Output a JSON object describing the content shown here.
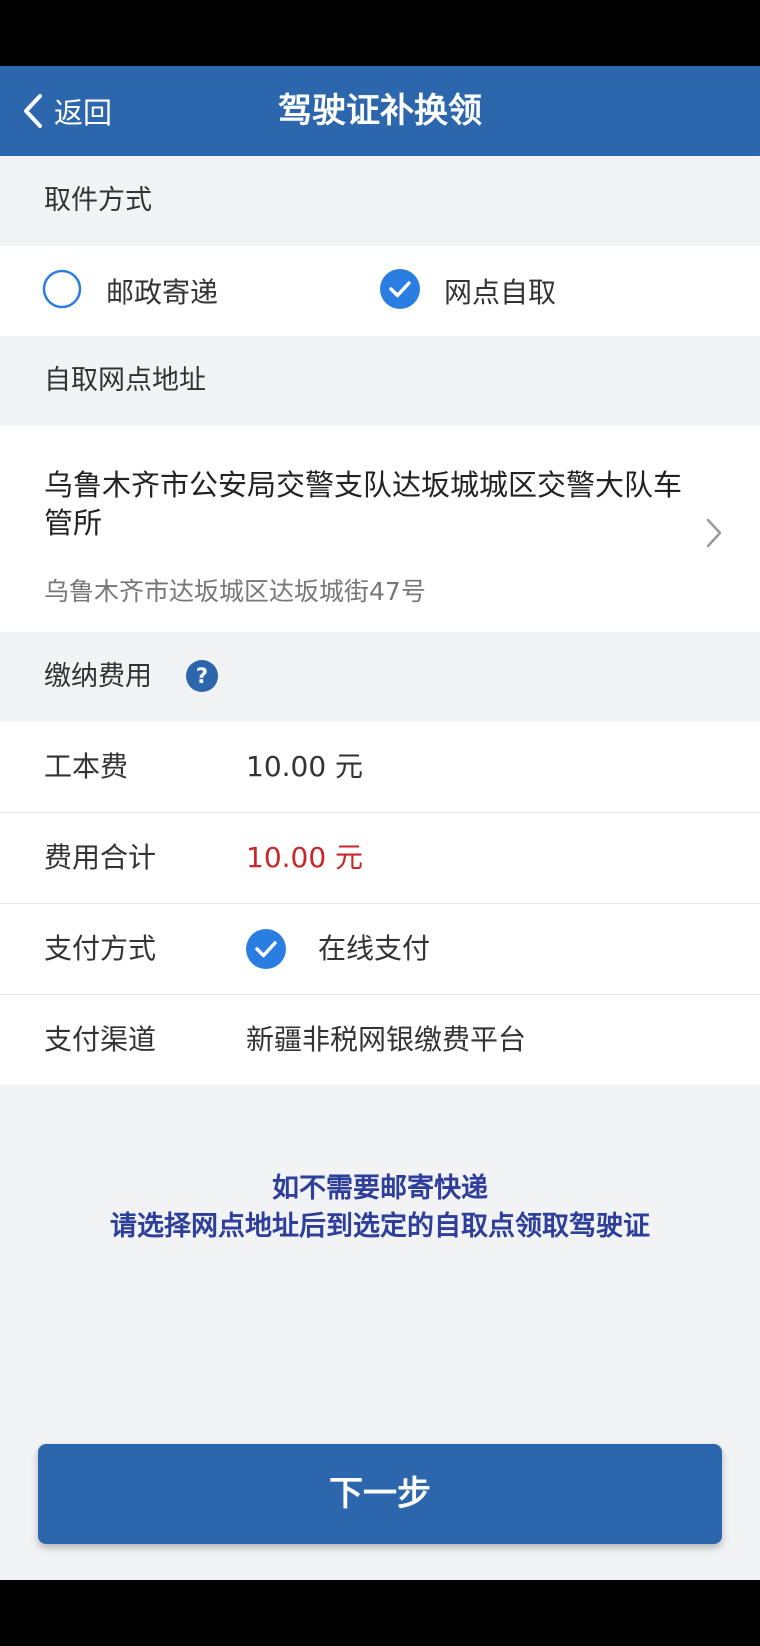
{
  "header": {
    "back_label": "返回",
    "title": "驾驶证补换领"
  },
  "pickup": {
    "section_title": "取件方式",
    "options": [
      {
        "label": "邮政寄递",
        "selected": false
      },
      {
        "label": "网点自取",
        "selected": true
      }
    ]
  },
  "address": {
    "section_title": "自取网点地址",
    "name": "乌鲁木齐市公安局交警支队达坂城城区交警大队车管所",
    "detail": "乌鲁木齐市达坂城区达坂城街47号"
  },
  "fees": {
    "section_title": "缴纳费用",
    "rows": [
      {
        "key": "工本费",
        "value": "10.00 元"
      },
      {
        "key": "费用合计",
        "value": "10.00 元"
      },
      {
        "key": "支付方式",
        "value": "在线支付"
      },
      {
        "key": "支付渠道",
        "value": "新疆非税网银缴费平台"
      }
    ]
  },
  "notice": {
    "line1": "如不需要邮寄快递",
    "line2": "请选择网点地址后到选定的自取点领取驾驶证"
  },
  "next_button": "下一步",
  "colors": {
    "primary": "#2c66ad",
    "accent": "#2a7de1",
    "amount": "#c9262a",
    "notice": "#2e3f9b"
  }
}
